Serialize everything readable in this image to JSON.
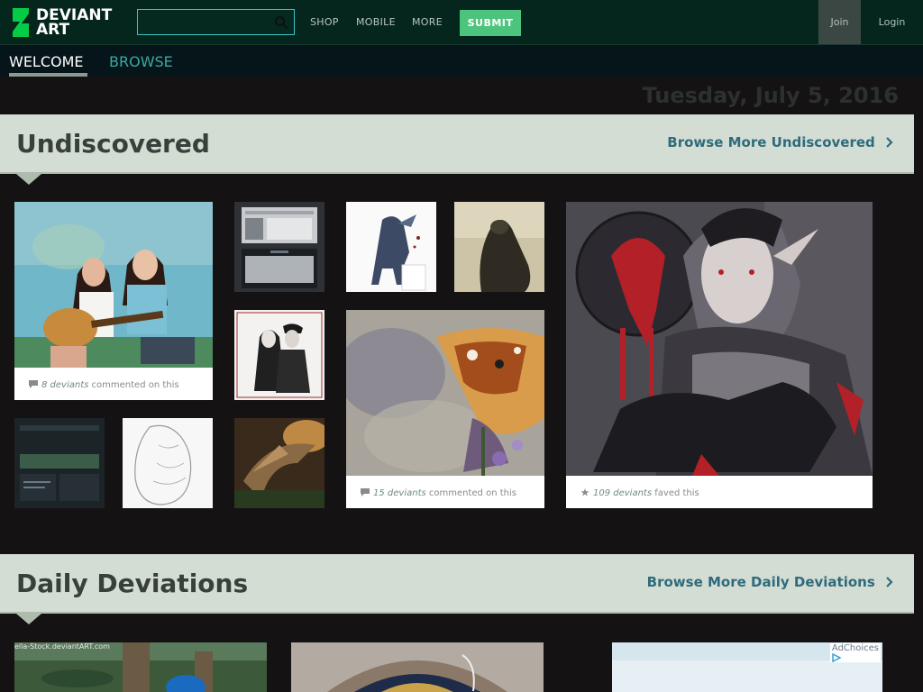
{
  "header": {
    "logo_line1": "DEVIANT",
    "logo_line2": "ART",
    "search_placeholder": "",
    "nav": [
      "SHOP",
      "MOBILE",
      "MORE"
    ],
    "submit_label": "SUBMIT",
    "join_label": "Join",
    "login_label": "Login"
  },
  "subnav": {
    "welcome": "WELCOME",
    "browse": "BROWSE"
  },
  "date": "Tuesday, July 5, 2016",
  "undiscovered": {
    "title": "Undiscovered",
    "more": "Browse More Undiscovered",
    "captions": {
      "girls_guitar": {
        "count": "8 deviants",
        "text": "commented on this",
        "icon": "comment-icon"
      },
      "butterfly": {
        "count": "15 deviants",
        "text": "commented on this",
        "icon": "comment-icon"
      },
      "vampire": {
        "count": "109 deviants",
        "text": "faved this",
        "icon": "star-icon"
      }
    }
  },
  "daily": {
    "title": "Daily Deviations",
    "more": "Browse More Daily Deviations",
    "watermark": "ella-Stock.deviantART.com",
    "adchoices": "AdChoices"
  },
  "colors": {
    "topbar": "#05261c",
    "accent_green": "#4dc47d",
    "section_bg": "#d4ddd3",
    "link_blue": "#2e6b7c"
  }
}
